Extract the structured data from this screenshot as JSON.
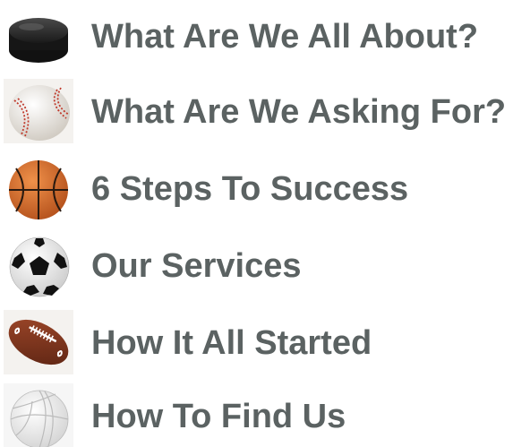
{
  "menu": {
    "items": [
      {
        "label": "What Are We All About?",
        "icon": "hockey-puck-icon"
      },
      {
        "label": "What Are We Asking For?",
        "icon": "baseball-icon"
      },
      {
        "label": "6 Steps To Success",
        "icon": "basketball-icon"
      },
      {
        "label": "Our Services",
        "icon": "soccer-ball-icon"
      },
      {
        "label": "How It All Started",
        "icon": "football-icon"
      },
      {
        "label": "How To Find Us",
        "icon": "volleyball-icon"
      }
    ],
    "text_color": "#5b6262"
  }
}
